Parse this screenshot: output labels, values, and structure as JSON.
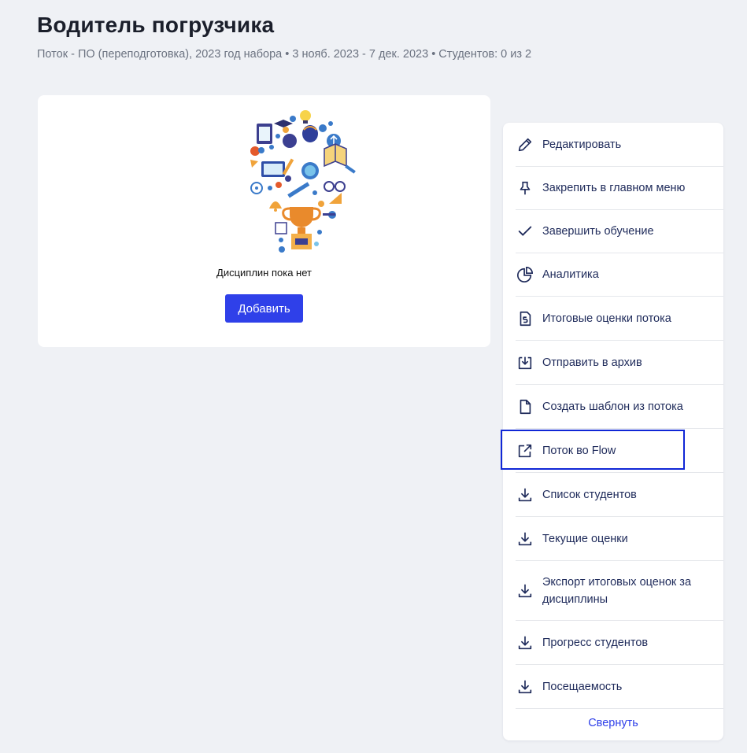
{
  "page": {
    "title": "Водитель погрузчика",
    "subtitle": "Поток - ПО (переподготовка), 2023 год набора • 3 нояб. 2023 - 7 дек. 2023 • Студентов: 0 из 2"
  },
  "empty_state": {
    "message": "Дисциплин пока нет",
    "add_label": "Добавить",
    "illustration_icon": "education-icons-lightbulb-illustration"
  },
  "menu": {
    "items": [
      {
        "label": "Редактировать",
        "icon": "pencil-icon"
      },
      {
        "label": "Закрепить в главном меню",
        "icon": "pin-icon"
      },
      {
        "label": "Завершить обучение",
        "icon": "check-icon"
      },
      {
        "label": "Аналитика",
        "icon": "pie-chart-icon"
      },
      {
        "label": "Итоговые оценки потока",
        "icon": "grade-document-icon"
      },
      {
        "label": "Отправить в архив",
        "icon": "archive-icon"
      },
      {
        "label": "Создать шаблон из потока",
        "icon": "document-icon"
      },
      {
        "label": "Поток во Flow",
        "icon": "external-link-icon"
      },
      {
        "label": "Список студентов",
        "icon": "download-icon"
      },
      {
        "label": "Текущие оценки",
        "icon": "download-icon"
      },
      {
        "label": "Экспорт итоговых оценок за дисциплины",
        "icon": "download-icon"
      },
      {
        "label": "Прогресс студентов",
        "icon": "download-icon"
      },
      {
        "label": "Посещаемость",
        "icon": "download-icon"
      }
    ],
    "collapse_label": "Свернуть"
  },
  "colors": {
    "accent": "#2f40e9",
    "background": "#eff1f5",
    "menu_text": "#1e2a5a",
    "highlight": "#1027d6"
  }
}
